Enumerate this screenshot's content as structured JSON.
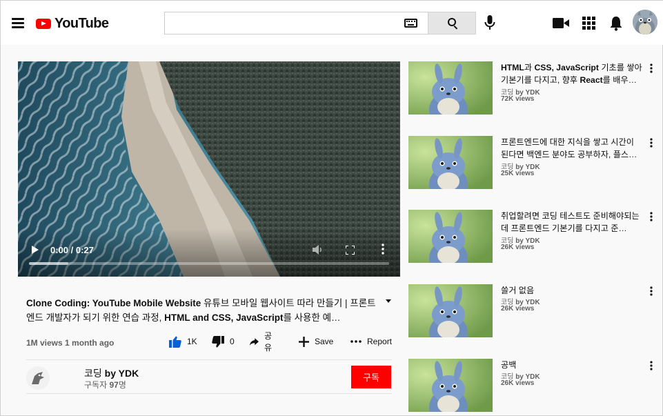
{
  "header": {
    "logo_text": "YouTube",
    "search": {
      "value": "",
      "placeholder": ""
    }
  },
  "player": {
    "time": "0:00 / 0:27",
    "buffered_fraction": 0.11
  },
  "video": {
    "title_part1": "Clone Coding: YouTube Mobile Website",
    "title_part2": " 유튜브 모바일 웹사이트 따라 만들기 | 프론트엔드 개발자가 되기 위한 연습 과정, ",
    "title_part3": "HTML and CSS, JavaScript",
    "title_part4": "를 사용한 예…",
    "meta": "1M views 1 month ago",
    "actions": {
      "like_count": "1K",
      "dislike_count": "0",
      "share_label": "공유",
      "save_label": "Save",
      "report_label": "Report"
    }
  },
  "channel": {
    "name_prefix": "코딩 ",
    "name_suffix": "by YDK",
    "subs_prefix": "구독자 ",
    "subs_count": "97",
    "subs_suffix": "명",
    "subscribe_label": "구독"
  },
  "related": [
    {
      "title": "<b>HTML</b>과 <b>CSS, JavaScript</b> 기초를 쌓아 기본기를 다지고, 향후 <b>React</b>를 배우…",
      "channel_prefix": "코딩 ",
      "channel_suffix": "by YDK",
      "views": "72K views"
    },
    {
      "title": "프론트엔드에 대한 지식을 쌓고 시간이 된다면 백엔드 분야도 공부하자, 플스…",
      "channel_prefix": "코딩 ",
      "channel_suffix": "by YDK",
      "views": "25K views"
    },
    {
      "title": "취업할려면 코딩 테스트도 준비해야되는데 프론트엔드 기본기를 다지고 준…",
      "channel_prefix": "코딩 ",
      "channel_suffix": "by YDK",
      "views": "26K views"
    },
    {
      "title": "쓸거 없음",
      "channel_prefix": "코딩 ",
      "channel_suffix": "by YDK",
      "views": "26K views"
    },
    {
      "title": "공백",
      "channel_prefix": "코딩 ",
      "channel_suffix": "by YDK",
      "views": "26K views"
    }
  ],
  "icons": {
    "menu": "hamburger-menu-icon",
    "search": "search-icon",
    "keyboard": "keyboard-icon",
    "mic": "microphone-icon",
    "upload": "video-camera-icon",
    "apps": "apps-grid-icon",
    "notifications": "bell-icon"
  },
  "colors": {
    "brand_red": "#ff0000",
    "like_blue": "#065fd4",
    "text_primary": "#0f0f0f",
    "text_secondary": "#606060"
  }
}
